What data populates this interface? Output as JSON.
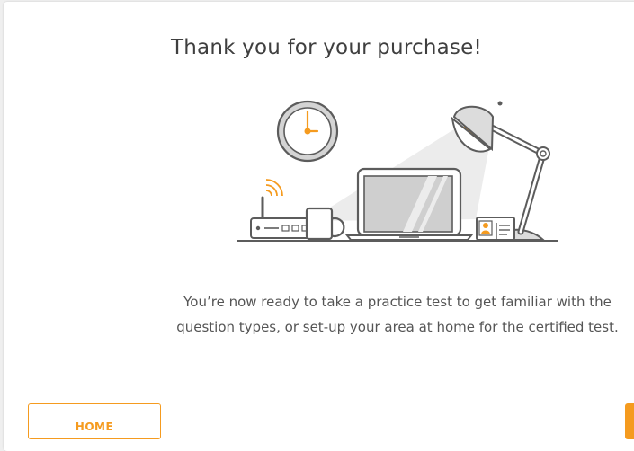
{
  "dialog": {
    "title": "Thank you for your purchase!",
    "message_line_1": "You’re now ready to take a practice test to get familiar with the",
    "message_line_2": "question types, or set-up your area at home for the certified test."
  },
  "illustration": {
    "icons": [
      "wall-clock-icon",
      "router-icon",
      "wifi-signal-icon",
      "coffee-mug-icon",
      "laptop-icon",
      "id-card-icon",
      "desk-lamp-icon"
    ]
  },
  "footer": {
    "home_label": "HOME"
  },
  "colors": {
    "accent": "#f59b1f",
    "text": "#3f3f3f",
    "line": "#5c5c5c"
  }
}
